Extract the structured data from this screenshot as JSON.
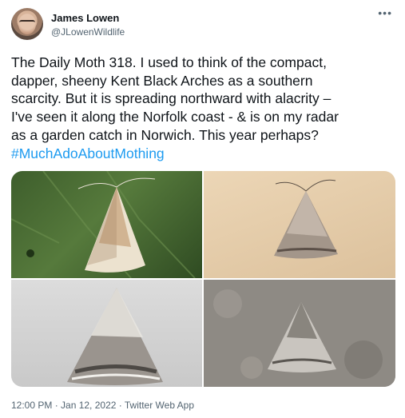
{
  "author": {
    "name": "James Lowen",
    "handle": "@JLowenWildlife"
  },
  "more_icon": "more-horizontal-icon",
  "tweet": {
    "text_lines": [
      "The Daily Moth 318. I used to think of the compact,",
      "dapper, sheeny Kent Black Arches as a southern",
      "scarcity. But it is spreading northward with alacrity –",
      "I've seen it along the Norfolk coast - & is on my radar",
      "as a garden catch in Norwich. This year perhaps?"
    ],
    "hashtag": "#MuchAdoAboutMothing"
  },
  "meta": {
    "timestamp": "12:00 PM · Jan 12, 2022 · Twitter Web App"
  },
  "colors": {
    "link": "#1d9bf0",
    "secondary_text": "#536471"
  }
}
